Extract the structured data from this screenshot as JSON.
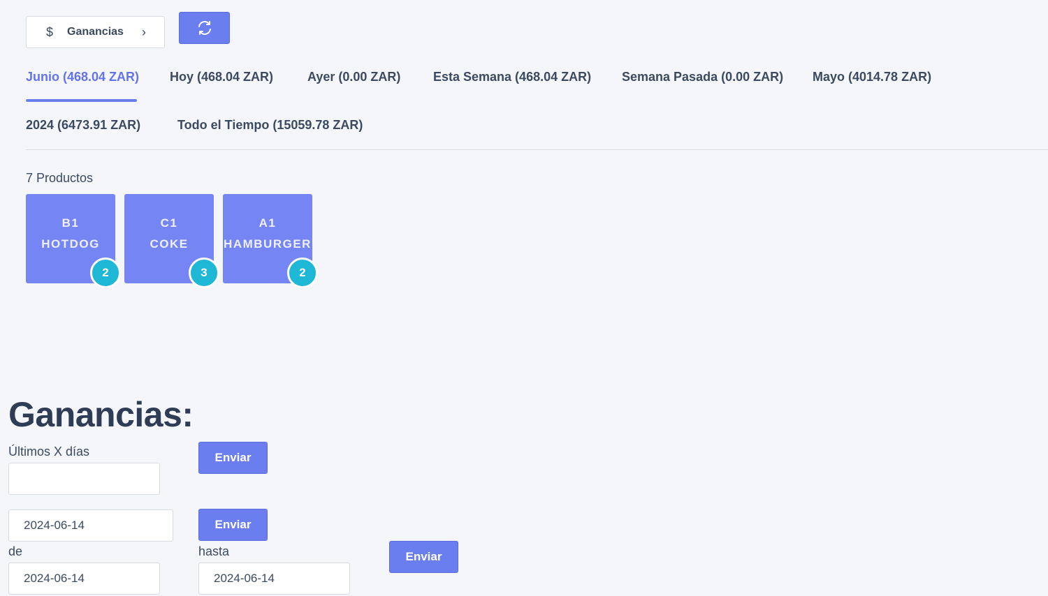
{
  "header": {
    "ganancias_label": "Ganancias",
    "dollar_icon": "$",
    "chevron_icon": "›"
  },
  "tabs": [
    {
      "label": "Junio (468.04 ZAR)",
      "active": true
    },
    {
      "label": "Hoy (468.04 ZAR)"
    },
    {
      "label": "Ayer (0.00 ZAR)"
    },
    {
      "label": "Esta Semana (468.04 ZAR)"
    },
    {
      "label": "Semana Pasada (0.00 ZAR)"
    },
    {
      "label": "Mayo (4014.78 ZAR)"
    },
    {
      "label": "2024 (6473.91 ZAR)"
    },
    {
      "label": "Todo el Tiempo (15059.78 ZAR)"
    }
  ],
  "products": {
    "count_label": "7 Productos",
    "items": [
      {
        "code": "B1",
        "name": "HOTDOG",
        "qty": "2"
      },
      {
        "code": "C1",
        "name": "COKE",
        "qty": "3"
      },
      {
        "code": "A1",
        "name": "HAMBURGER",
        "qty": "2"
      }
    ]
  },
  "earnings": {
    "title": "Ganancias:",
    "last_days_label": "Últimos X días",
    "last_days_value": "",
    "submit_label": "Enviar",
    "single_date_value": "2024-06-14",
    "from_label": "de",
    "to_label": "hasta",
    "from_value": "2024-06-14",
    "to_value": "2024-06-14"
  },
  "colors": {
    "accent": "#6b7ef0",
    "badge": "#1eb8d6",
    "background": "#f5f6fa"
  }
}
